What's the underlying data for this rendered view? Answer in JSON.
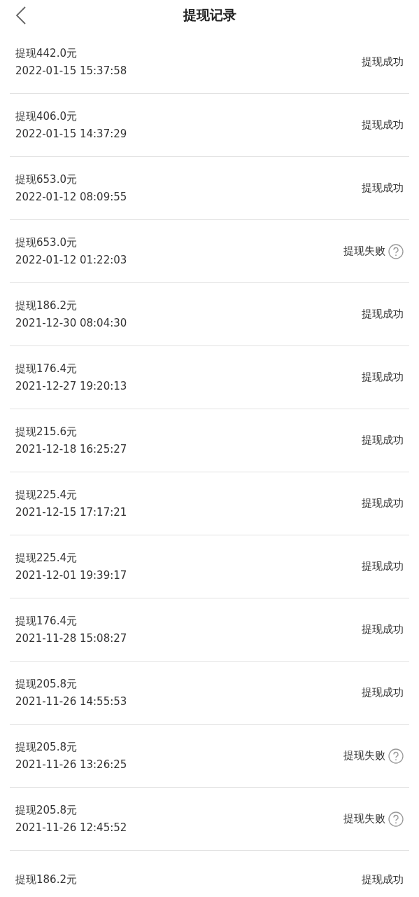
{
  "header": {
    "title": "提现记录"
  },
  "records": [
    {
      "amount": "提现442.0元",
      "time": "2022-01-15 15:37:58",
      "status": "提现成功",
      "kind": "success"
    },
    {
      "amount": "提现406.0元",
      "time": "2022-01-15 14:37:29",
      "status": "提现成功",
      "kind": "success"
    },
    {
      "amount": "提现653.0元",
      "time": "2022-01-12 08:09:55",
      "status": "提现成功",
      "kind": "success"
    },
    {
      "amount": "提现653.0元",
      "time": "2022-01-12 01:22:03",
      "status": "提现失败",
      "kind": "failed"
    },
    {
      "amount": "提现186.2元",
      "time": "2021-12-30 08:04:30",
      "status": "提现成功",
      "kind": "success"
    },
    {
      "amount": "提现176.4元",
      "time": "2021-12-27 19:20:13",
      "status": "提现成功",
      "kind": "success"
    },
    {
      "amount": "提现215.6元",
      "time": "2021-12-18 16:25:27",
      "status": "提现成功",
      "kind": "success"
    },
    {
      "amount": "提现225.4元",
      "time": "2021-12-15 17:17:21",
      "status": "提现成功",
      "kind": "success"
    },
    {
      "amount": "提现225.4元",
      "time": "2021-12-01 19:39:17",
      "status": "提现成功",
      "kind": "success"
    },
    {
      "amount": "提现176.4元",
      "time": "2021-11-28 15:08:27",
      "status": "提现成功",
      "kind": "success"
    },
    {
      "amount": "提现205.8元",
      "time": "2021-11-26 14:55:53",
      "status": "提现成功",
      "kind": "success"
    },
    {
      "amount": "提现205.8元",
      "time": "2021-11-26 13:26:25",
      "status": "提现失败",
      "kind": "failed"
    },
    {
      "amount": "提现205.8元",
      "time": "2021-11-26 12:45:52",
      "status": "提现失败",
      "kind": "failed"
    },
    {
      "amount": "提现186.2元",
      "status": "提现成功",
      "kind": "success"
    }
  ]
}
